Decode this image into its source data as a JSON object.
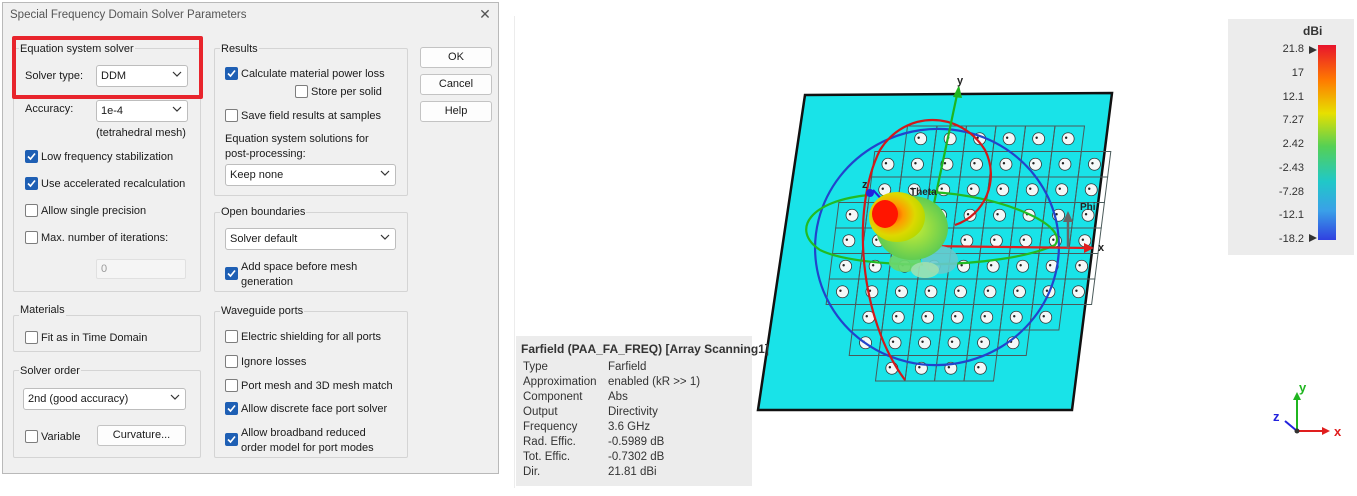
{
  "dialog": {
    "title": "Special Frequency Domain Solver Parameters",
    "close_glyph": "✕",
    "equation_solver": {
      "group_label": "Equation system solver",
      "solver_type_label": "Solver type:",
      "solver_type_value": "DDM",
      "accuracy_label": "Accuracy:",
      "accuracy_value": "1e-4",
      "mesh_note": "(tetrahedral mesh)",
      "low_freq_label": "Low frequency stabilization",
      "low_freq_checked": true,
      "accel_label": "Use accelerated recalculation",
      "accel_checked": true,
      "single_prec_label": "Allow single precision",
      "single_prec_checked": false,
      "max_iter_label": "Max. number of iterations:",
      "max_iter_checked": false,
      "max_iter_value": "0"
    },
    "materials": {
      "group_label": "Materials",
      "fit_label": "Fit as in Time Domain",
      "fit_checked": false
    },
    "solver_order": {
      "group_label": "Solver order",
      "value": "2nd (good accuracy)",
      "variable_label": "Variable",
      "variable_checked": false,
      "curvature_label": "Curvature..."
    },
    "results": {
      "group_label": "Results",
      "calc_loss_label": "Calculate material power loss",
      "calc_loss_checked": true,
      "store_per_solid_label": "Store per solid",
      "store_per_solid_checked": false,
      "save_field_label": "Save field results at samples",
      "save_field_checked": false,
      "eq_solutions_line1": "Equation system solutions for",
      "eq_solutions_line2": "post-processing:",
      "eq_solutions_value": "Keep none"
    },
    "open_boundaries": {
      "group_label": "Open boundaries",
      "value": "Solver default",
      "add_space_line1": "Add space before mesh",
      "add_space_line2": "generation",
      "add_space_checked": true
    },
    "waveguide_ports": {
      "group_label": "Waveguide ports",
      "shielding_label": "Electric shielding for all ports",
      "shielding_checked": false,
      "ignore_losses_label": "Ignore losses",
      "ignore_losses_checked": false,
      "mesh_match_label": "Port mesh and 3D mesh match",
      "mesh_match_checked": false,
      "discrete_face_label": "Allow discrete face port solver",
      "discrete_face_checked": true,
      "broadband_line1": "Allow broadband reduced",
      "broadband_line2": "order model for port modes",
      "broadband_checked": true
    },
    "buttons": {
      "ok": "OK",
      "cancel": "Cancel",
      "help": "Help"
    }
  },
  "view3d": {
    "legend": {
      "unit": "dBi",
      "ticks": [
        "21.8",
        "17",
        "12.1",
        "7.27",
        "2.42",
        "-2.43",
        "-7.28",
        "-12.1",
        "-18.2"
      ]
    },
    "axis_labels": {
      "x": "x",
      "y": "y",
      "z": "z",
      "theta": "Theta",
      "phi": "Phi"
    },
    "triad_labels": {
      "x": "x",
      "y": "y",
      "z": "z"
    },
    "info": {
      "title": "Farfield (PAA_FA_FREQ) [Array Scanning1]",
      "rows": [
        {
          "key": "Type",
          "value": "Farfield"
        },
        {
          "key": "Approximation",
          "value": "enabled (kR >> 1)"
        },
        {
          "key": "Component",
          "value": "Abs"
        },
        {
          "key": "Output",
          "value": "Directivity"
        },
        {
          "key": "Frequency",
          "value": "3.6 GHz"
        },
        {
          "key": "Rad. Effic.",
          "value": "-0.5989 dB"
        },
        {
          "key": "Tot. Effic.",
          "value": "-0.7302 dB"
        },
        {
          "key": "Dir.",
          "value": "21.81 dBi"
        }
      ]
    },
    "colors": {
      "substrate": "#19e3e8",
      "x_axis": "#e01e1e",
      "y_axis": "#1fb51f",
      "z_axis": "#2222dd",
      "theta_arc": "#d11a1a",
      "phi_arc": "#2244cc",
      "green_arc": "#22bb22"
    }
  }
}
